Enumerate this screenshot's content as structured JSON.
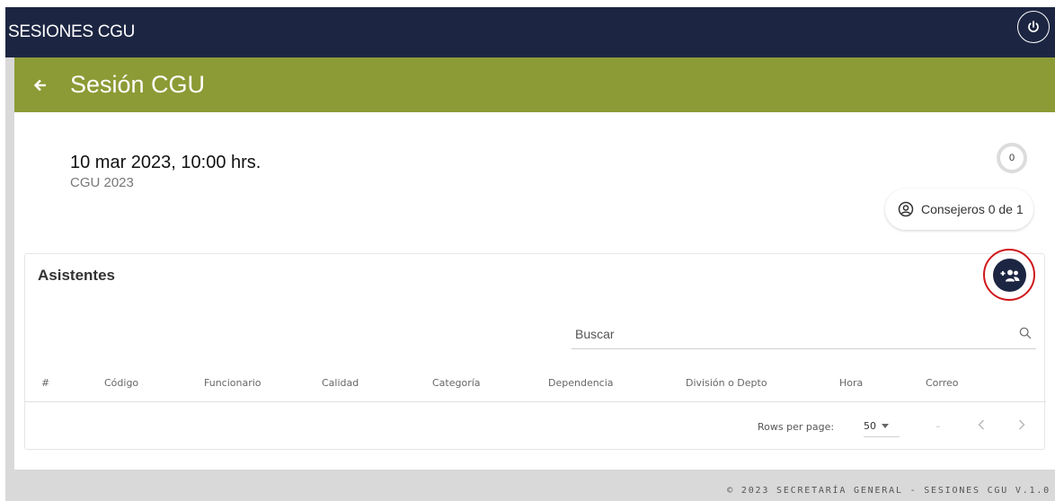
{
  "topbar": {
    "title": "SESIONES CGU"
  },
  "header": {
    "title": "Sesión CGU"
  },
  "session": {
    "date": "10 mar 2023, 10:00 hrs.",
    "subtitle": "CGU 2023",
    "count": "0",
    "consejeros": "Consejeros 0 de 1"
  },
  "asistentes": {
    "title": "Asistentes",
    "search_placeholder": "Buscar",
    "columns": [
      "#",
      "Código",
      "Funcionario",
      "Calidad",
      "Categoría",
      "Dependencia",
      "División o Depto",
      "Hora",
      "Correo"
    ],
    "rows_per_page_label": "Rows per page:",
    "rows_per_page_value": "50",
    "range": "–"
  },
  "footer": {
    "text": "© 2023 SECRETARÍA GENERAL - SESIONES CGU V.1.0"
  },
  "colors": {
    "navy": "#1c2642",
    "olive": "#8c9b35",
    "highlight": "#d0171b"
  },
  "icons": [
    "power-icon",
    "arrow-left-icon",
    "user-circle-icon",
    "add-group-icon",
    "search-icon",
    "chevron-left-icon",
    "chevron-right-icon"
  ]
}
